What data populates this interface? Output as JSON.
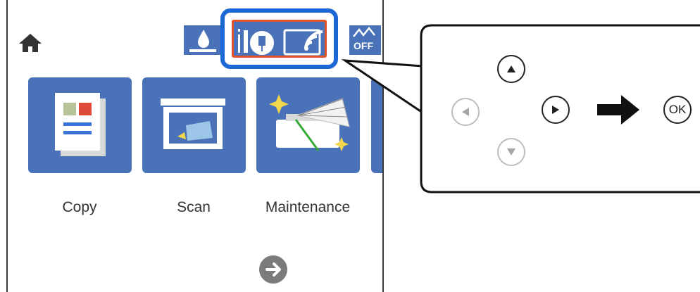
{
  "screen": {
    "icons": {
      "home": "home-icon",
      "ink": "ink-drop-icon",
      "ethernet": "wired-lan-icon",
      "wifi": "wifi-icon",
      "wifi_direct": "wifi-direct-off-icon",
      "next": "arrow-right-circle-icon"
    },
    "wifi_direct_badge": "OFF",
    "tiles": [
      {
        "label": "Copy",
        "icon": "copy-document-icon"
      },
      {
        "label": "Scan",
        "icon": "scanner-icon"
      },
      {
        "label": "Maintenance",
        "icon": "maintenance-printer-icon"
      }
    ]
  },
  "control_panel": {
    "buttons": {
      "up": "up-triangle-icon",
      "left": "left-triangle-icon",
      "right": "right-triangle-icon",
      "down": "down-triangle-icon"
    },
    "ok_label": "OK",
    "arrow": "right-arrow-icon"
  },
  "colors": {
    "tile": "#4a72b8",
    "highlight_outer": "#1d66d6",
    "highlight_inner": "#e2532c"
  }
}
